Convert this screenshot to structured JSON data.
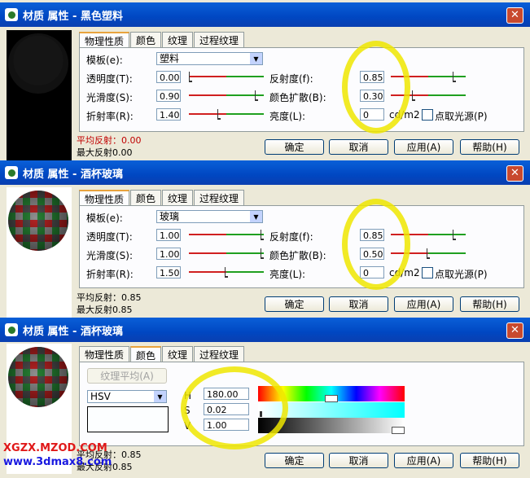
{
  "windows": [
    {
      "title": "材质 属性 - 黑色塑料",
      "tabs": [
        "物理性质",
        "颜色",
        "纹理",
        "过程纹理"
      ],
      "template_label": "模板(e):",
      "template_value": "塑料",
      "transparency_label": "透明度(T):",
      "transparency_value": "0.00",
      "transparency_level": 0.0,
      "reflectance_label": "反射度(f):",
      "reflectance_value": "0.85",
      "reflectance_level": 0.85,
      "gloss_label": "光滑度(S):",
      "gloss_value": "0.90",
      "gloss_level": 0.9,
      "color_spread_label": "颜色扩散(B):",
      "color_spread_value": "0.30",
      "color_spread_level": 0.3,
      "refraction_label": "折射率(R):",
      "refraction_value": "1.40",
      "refraction_level": 0.4,
      "brightness_label": "亮度(L):",
      "brightness_value": "0",
      "brightness_unit": "cd/m2",
      "light_source_label": "点取光源(P)",
      "avg_reflect": "平均反射：0.00",
      "max_reflect": "最大反射0.00",
      "ok": "确定",
      "cancel": "取消",
      "apply": "应用(A)",
      "help": "帮助(H)"
    },
    {
      "title": "材质 属性 - 酒杯玻璃",
      "tabs": [
        "物理性质",
        "颜色",
        "纹理",
        "过程纹理"
      ],
      "template_label": "模板(e):",
      "template_value": "玻璃",
      "transparency_label": "透明度(T):",
      "transparency_value": "1.00",
      "transparency_level": 1.0,
      "reflectance_label": "反射度(f):",
      "reflectance_value": "0.85",
      "reflectance_level": 0.85,
      "gloss_label": "光滑度(S):",
      "gloss_value": "1.00",
      "gloss_level": 1.0,
      "color_spread_label": "颜色扩散(B):",
      "color_spread_value": "0.50",
      "color_spread_level": 0.5,
      "refraction_label": "折射率(R):",
      "refraction_value": "1.50",
      "refraction_level": 0.5,
      "brightness_label": "亮度(L):",
      "brightness_value": "0",
      "brightness_unit": "cd/m2",
      "light_source_label": "点取光源(P)",
      "avg_reflect": "平均反射：0.85",
      "max_reflect": "最大反射0.85",
      "ok": "确定",
      "cancel": "取消",
      "apply": "应用(A)",
      "help": "帮助(H)"
    },
    {
      "title": "材质 属性 - 酒杯玻璃",
      "tabs": [
        "物理性质",
        "颜色",
        "纹理",
        "过程纹理"
      ],
      "texture_avg_button": "纹理平均(A)",
      "color_model": "HSV",
      "h_label": "H",
      "h_value": "180.00",
      "h_level": 0.5,
      "s_label": "S",
      "s_value": "0.02",
      "s_level": 0.02,
      "v_label": "V",
      "v_value": "1.00",
      "v_level": 1.0,
      "avg_reflect": "平均反射：0.85",
      "max_reflect": "最大反射0.85",
      "ok": "确定",
      "cancel": "取消",
      "apply": "应用(A)",
      "help": "帮助(H)"
    }
  ],
  "watermark": {
    "line1": "XGZX.MZOD.COM",
    "line2": "www.3dmax8.com"
  },
  "colors": {
    "titlebar": "#0047c2",
    "highlight": "#eee600",
    "watermark1": "#e01818",
    "watermark2": "#1818e0"
  }
}
